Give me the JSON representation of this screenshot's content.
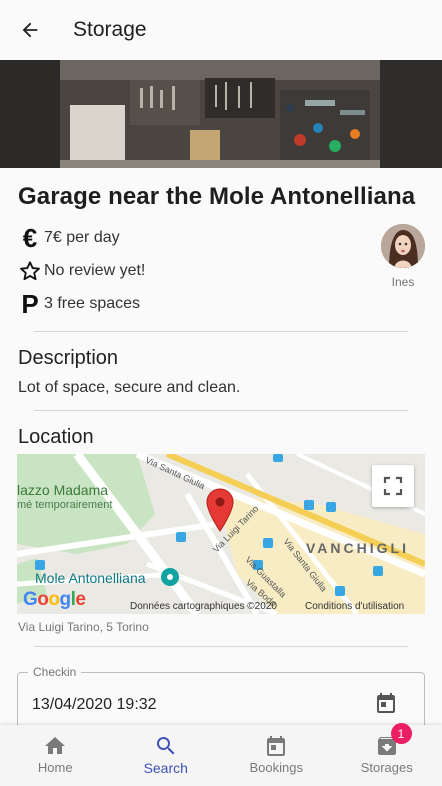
{
  "appbar": {
    "title": "Storage",
    "back_icon": "arrow-back-icon"
  },
  "storage": {
    "title": "Garage near the Mole Antonelliana",
    "price_icon": "€",
    "price": "7€ per day",
    "rating": "No review yet!",
    "parking_icon": "P",
    "spaces": "3 free spaces",
    "owner_name": "Ines"
  },
  "description": {
    "heading": "Description",
    "text": "Lot of space, secure and clean."
  },
  "location": {
    "heading": "Location",
    "address": "Via Luigi Tarino, 5 Torino",
    "map": {
      "labels": {
        "palazzo": "lazzo Madama",
        "temp": "mé temporairement",
        "mole": "Mole Antonelliana",
        "vanchiglia": "VANCHIGLI",
        "santa_giulia_1": "Via Santa Giulia",
        "santa_giulia_2": "Via Santa Giulia",
        "tarino": "Via Luigi Tarino",
        "guastalla": "Via Guastalla",
        "bodoni": "Via Bodo"
      },
      "google": [
        "G",
        "o",
        "o",
        "g",
        "l",
        "e"
      ],
      "google_colors": [
        "#4285F4",
        "#EA4335",
        "#FBBC05",
        "#4285F4",
        "#34A853",
        "#EA4335"
      ],
      "credits": "Données cartographiques ©2020",
      "terms": "Conditions d'utilisation"
    }
  },
  "checkin": {
    "label": "Checkin",
    "value": "13/04/2020 19:32"
  },
  "nav": {
    "items": [
      {
        "label": "Home",
        "icon": "home-icon"
      },
      {
        "label": "Search",
        "icon": "search-icon"
      },
      {
        "label": "Bookings",
        "icon": "calendar-icon"
      },
      {
        "label": "Storages",
        "icon": "archive-icon"
      }
    ],
    "active": "Search",
    "badge": "1"
  },
  "colors": {
    "accent": "#3f51b5",
    "badge": "#e91e63",
    "pin": "#e53935"
  }
}
